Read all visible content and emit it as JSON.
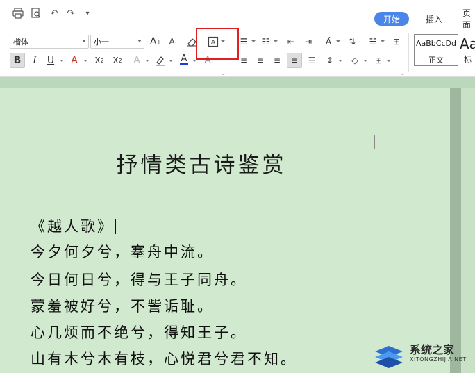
{
  "tabs": {
    "active": "开始",
    "others": [
      "插入",
      "页面"
    ]
  },
  "toolbar": {
    "font_name": "楷体",
    "font_size": "小一",
    "clear_format_tip": "clear-format",
    "text_box_label": "A"
  },
  "styles": [
    {
      "sample": "AaBbCcDd",
      "name": "正文"
    },
    {
      "sample": "Aa",
      "name": "标"
    }
  ],
  "document": {
    "title": "抒情类古诗鉴赏",
    "poem_title": "《越人歌》",
    "lines": [
      "今夕何夕兮，搴舟中流。",
      "今日何日兮，得与王子同舟。",
      "蒙羞被好兮，不訾诟耻。",
      "心几烦而不绝兮，得知王子。",
      "山有木兮木有枝，心悦君兮君不知。"
    ]
  },
  "watermark": {
    "name": "系统之家",
    "url": "XITONGZHIJIA.NET"
  },
  "colors": {
    "page": "#d1eacf",
    "accent": "#4a86e8",
    "highlight": "#e02020"
  }
}
